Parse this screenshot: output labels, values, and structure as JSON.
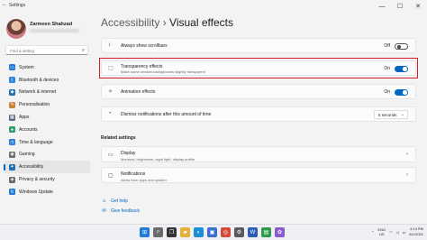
{
  "window": {
    "app_title": "Settings",
    "back_glyph": "←",
    "minimize": "—",
    "maximize": "☐",
    "close": "✕"
  },
  "user": {
    "name": "Zarmeen Shahzad"
  },
  "search": {
    "placeholder": "Find a setting",
    "icon": "search-icon"
  },
  "nav": [
    {
      "label": "System",
      "icon": "monitor-icon",
      "color": "#1f7bd6",
      "glyph": "▭"
    },
    {
      "label": "Bluetooth & devices",
      "icon": "bluetooth-icon",
      "color": "#2b88d8",
      "glyph": "ᛒ"
    },
    {
      "label": "Network & internet",
      "icon": "wifi-icon",
      "color": "#1f6fb5",
      "glyph": "◆"
    },
    {
      "label": "Personalisation",
      "icon": "brush-icon",
      "color": "#c8823a",
      "glyph": "✎"
    },
    {
      "label": "Apps",
      "icon": "apps-icon",
      "color": "#5a6b85",
      "glyph": "▦"
    },
    {
      "label": "Accounts",
      "icon": "person-icon",
      "color": "#2f9e6a",
      "glyph": "●"
    },
    {
      "label": "Time & language",
      "icon": "clock-icon",
      "color": "#1f7bd6",
      "glyph": "◷"
    },
    {
      "label": "Gaming",
      "icon": "gamepad-icon",
      "color": "#6b6b6b",
      "glyph": "◉"
    },
    {
      "label": "Accessibility",
      "icon": "accessibility-icon",
      "color": "#1f6fb5",
      "glyph": "✦"
    },
    {
      "label": "Privacy & security",
      "icon": "shield-icon",
      "color": "#6b6b6b",
      "glyph": "◈"
    },
    {
      "label": "Windows Update",
      "icon": "update-icon",
      "color": "#1f7bd6",
      "glyph": "↻"
    }
  ],
  "breadcrumb": {
    "parent": "Accessibility",
    "separator": "›",
    "current": "Visual effects"
  },
  "settings": {
    "scrollbars": {
      "title": "Always show scrollbars",
      "state": "Off"
    },
    "transparency": {
      "title": "Transparency effects",
      "subtitle": "Make some window backgrounds slightly transparent",
      "state": "On"
    },
    "animation": {
      "title": "Animation effects",
      "state": "On"
    },
    "dismiss": {
      "title": "Dismiss notifications after this amount of time",
      "value": "5 seconds"
    }
  },
  "related": {
    "heading": "Related settings",
    "display": {
      "title": "Display",
      "subtitle": "Monitors, brightness, night light, display profile"
    },
    "notifications": {
      "title": "Notifications",
      "subtitle": "Alerts from apps and system"
    }
  },
  "help": {
    "get_help": "Get help",
    "give_feedback": "Give feedback"
  },
  "taskbar": {
    "apps": [
      {
        "icon": "start-icon",
        "color": "#1f7bd6",
        "glyph": "⊞"
      },
      {
        "icon": "search-icon",
        "color": "#6b6b6b",
        "glyph": "⌕"
      },
      {
        "icon": "task-view-icon",
        "color": "#333333",
        "glyph": "❐"
      },
      {
        "icon": "file-explorer-icon",
        "color": "#e4b23a",
        "glyph": "▰"
      },
      {
        "icon": "edge-icon",
        "color": "#1c8fd6",
        "glyph": "◐"
      },
      {
        "icon": "store-icon",
        "color": "#3b6fd1",
        "glyph": "▣"
      },
      {
        "icon": "chrome-icon",
        "color": "#d64a3a",
        "glyph": "◎"
      },
      {
        "icon": "settings-icon",
        "color": "#5a5a5a",
        "glyph": "⚙"
      },
      {
        "icon": "word-icon",
        "color": "#2b5cb8",
        "glyph": "W"
      },
      {
        "icon": "green-app-icon",
        "color": "#2e9b4a",
        "glyph": "▤"
      },
      {
        "icon": "photos-icon",
        "color": "#8a5ad0",
        "glyph": "✿"
      }
    ],
    "language_top": "ENG",
    "language_bottom": "US",
    "time": "4:14 PM",
    "date": "6/1/2021"
  }
}
